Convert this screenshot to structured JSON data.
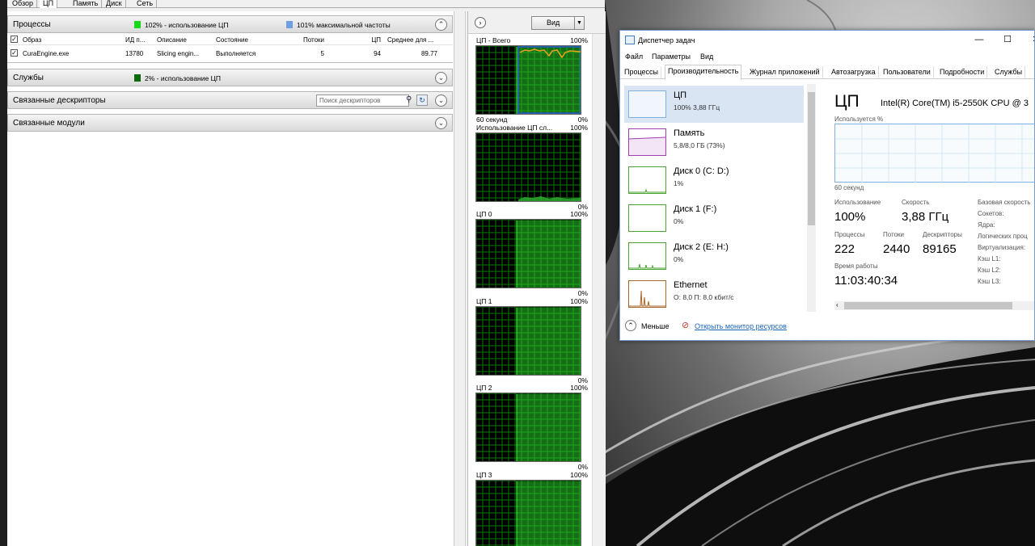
{
  "resmon": {
    "tabs": [
      "Обзор",
      "ЦП",
      "Память",
      "Диск",
      "Сеть"
    ],
    "processes": {
      "title": "Процессы",
      "usage_text": "102% - использование ЦП",
      "max_freq_text": "101% максимальной частоты",
      "usage_color": "#18d818",
      "freq_color": "#6ea0e0",
      "columns": [
        "Образ",
        "ИД п...",
        "Описание",
        "Состояние",
        "Потоки",
        "ЦП",
        "Среднее для ..."
      ],
      "rows": [
        {
          "image": "CuraEngine.exe",
          "pid": "13780",
          "desc": "Slicing engin...",
          "state": "Выполняется",
          "threads": "5",
          "cpu": "94",
          "avg": "89.77"
        }
      ]
    },
    "services": {
      "title": "Службы",
      "usage_text": "2% - использование ЦП",
      "usage_color": "#0b6b0b"
    },
    "handles": {
      "title": "Связанные дескрипторы",
      "search_placeholder": "Поиск дескрипторов"
    },
    "modules": {
      "title": "Связанные модули"
    },
    "view_button": "Вид",
    "graphs": [
      {
        "label": "ЦП - Всего",
        "max": "100%",
        "footer_left": "60 секунд",
        "footer_right": "0%"
      },
      {
        "label": "Использование ЦП сл...",
        "max": "100%",
        "footer_left": "",
        "footer_right": "0%"
      },
      {
        "label": "ЦП 0",
        "max": "100%",
        "footer_left": "",
        "footer_right": "0%"
      },
      {
        "label": "ЦП 1",
        "max": "100%",
        "footer_left": "",
        "footer_right": "0%"
      },
      {
        "label": "ЦП 2",
        "max": "100%",
        "footer_left": "",
        "footer_right": "0%"
      },
      {
        "label": "ЦП 3",
        "max": "100%",
        "footer_left": "",
        "footer_right": ""
      }
    ]
  },
  "taskmgr": {
    "title": "Диспетчер задач",
    "menu": [
      "Файл",
      "Параметры",
      "Вид"
    ],
    "tabs": [
      "Процессы",
      "Производительность",
      "Журнал приложений",
      "Автозагрузка",
      "Пользователи",
      "Подробности",
      "Службы"
    ],
    "sidebar": [
      {
        "name": "ЦП",
        "value": "100% 3,88 ГГц"
      },
      {
        "name": "Память",
        "value": "5,8/8,0 ГБ (73%)"
      },
      {
        "name": "Диск 0 (C: D:)",
        "value": "1%"
      },
      {
        "name": "Диск 1 (F:)",
        "value": "0%"
      },
      {
        "name": "Диск 2 (E: H:)",
        "value": "0%"
      },
      {
        "name": "Ethernet",
        "value": "О: 8,0 П: 8,0 кбит/с"
      }
    ],
    "footer": {
      "less": "Меньше",
      "open_monitor": "Открыть монитор ресурсов"
    },
    "cpu": {
      "heading": "ЦП",
      "model": "Intel(R) Core(TM) i5-2550K CPU @ 3",
      "graph_caption": "Используется %",
      "graph_footer": "60 секунд",
      "usage_label": "Использование",
      "usage": "100%",
      "speed_label": "Скорость",
      "speed": "3,88 ГГц",
      "processes_label": "Процессы",
      "processes": "222",
      "threads_label": "Потоки",
      "threads": "2440",
      "handles_label": "Дескрипторы",
      "handles": "89165",
      "uptime_label": "Время работы",
      "uptime": "11:03:40:34",
      "details": [
        "Базовая скорость",
        "Сокетов:",
        "Ядра:",
        "Логических проц",
        "Виртуализация:",
        "Кэш L1:",
        "Кэш L2:",
        "Кэш L3:"
      ]
    }
  }
}
